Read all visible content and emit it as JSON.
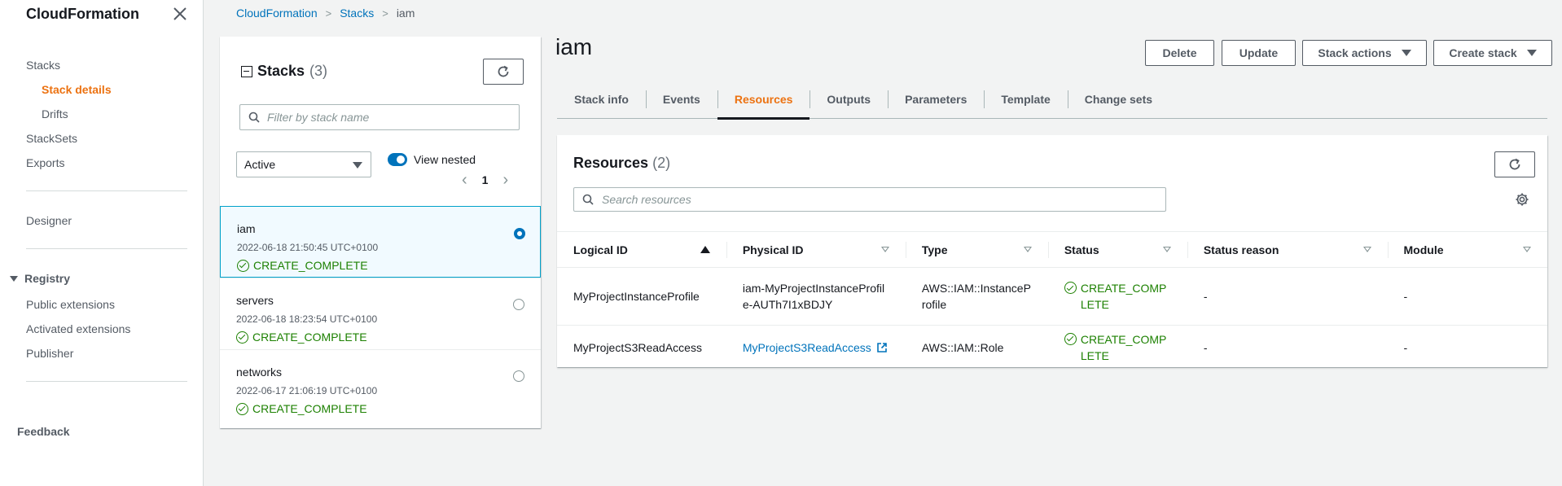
{
  "sidebar": {
    "title": "CloudFormation",
    "items": {
      "stacks": "Stacks",
      "stack_details": "Stack details",
      "drifts": "Drifts",
      "stacksets": "StackSets",
      "exports": "Exports",
      "designer": "Designer",
      "registry": "Registry",
      "public_extensions": "Public extensions",
      "activated_extensions": "Activated extensions",
      "publisher": "Publisher"
    },
    "feedback": "Feedback"
  },
  "breadcrumb": [
    "CloudFormation",
    "Stacks",
    "iam"
  ],
  "stacks_panel": {
    "title": "Stacks",
    "count": "(3)",
    "filter_placeholder": "Filter by stack name",
    "status_filter": "Active",
    "view_nested_label": "View nested",
    "page": "1",
    "stacks": [
      {
        "name": "iam",
        "date": "2022-06-18 21:50:45 UTC+0100",
        "status": "CREATE_COMPLETE",
        "selected": true
      },
      {
        "name": "servers",
        "date": "2022-06-18 18:23:54 UTC+0100",
        "status": "CREATE_COMPLETE",
        "selected": false
      },
      {
        "name": "networks",
        "date": "2022-06-17 21:06:19 UTC+0100",
        "status": "CREATE_COMPLETE",
        "selected": false
      }
    ]
  },
  "main": {
    "title": "iam",
    "buttons": {
      "delete": "Delete",
      "update": "Update",
      "stack_actions": "Stack actions",
      "create_stack": "Create stack"
    },
    "tabs": [
      "Stack info",
      "Events",
      "Resources",
      "Outputs",
      "Parameters",
      "Template",
      "Change sets"
    ],
    "active_tab": "Resources"
  },
  "resources": {
    "title": "Resources",
    "count": "(2)",
    "search_placeholder": "Search resources",
    "columns": [
      "Logical ID",
      "Physical ID",
      "Type",
      "Status",
      "Status reason",
      "Module"
    ],
    "rows": [
      {
        "logical_id": "MyProjectInstanceProfile",
        "physical_id": "iam-MyProjectInstanceProfile-AUTh7I1xBDJY",
        "type": "AWS::IAM::InstanceProfile",
        "status": "CREATE_COMPLETE",
        "status_reason": "-",
        "module": "-"
      },
      {
        "logical_id": "MyProjectS3ReadAccess",
        "physical_id": "MyProjectS3ReadAccess",
        "type": "AWS::IAM::Role",
        "status": "CREATE_COMPLETE",
        "status_reason": "-",
        "module": "-"
      }
    ]
  },
  "colors": {
    "accent_orange": "#ec7211",
    "link_blue": "#0073bb",
    "success_green": "#1d8102"
  }
}
